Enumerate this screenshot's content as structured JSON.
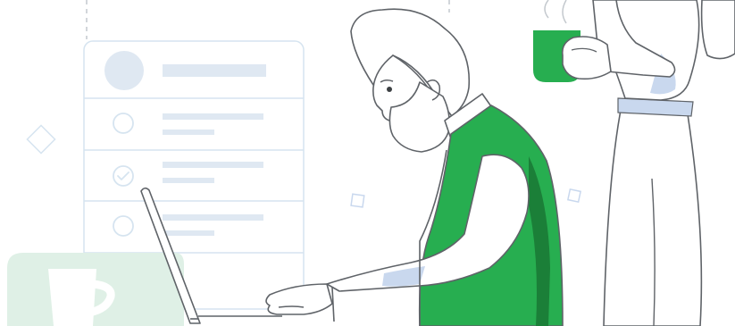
{
  "illustration": {
    "alt": "",
    "colors": {
      "accent": "#27ae50",
      "accent_dark": "#1b7f38",
      "line": "#5f6368",
      "pale_blue": "#dfe8f2",
      "pale_line": "#d6e4f0",
      "shadow_blue": "#c9d8ee",
      "mint": "#dff0e6",
      "background": "#ffffff"
    },
    "checklist": {
      "items": [
        {
          "state": "avatar"
        },
        {
          "state": "unchecked"
        },
        {
          "state": "checked"
        },
        {
          "state": "unchecked"
        }
      ]
    }
  }
}
